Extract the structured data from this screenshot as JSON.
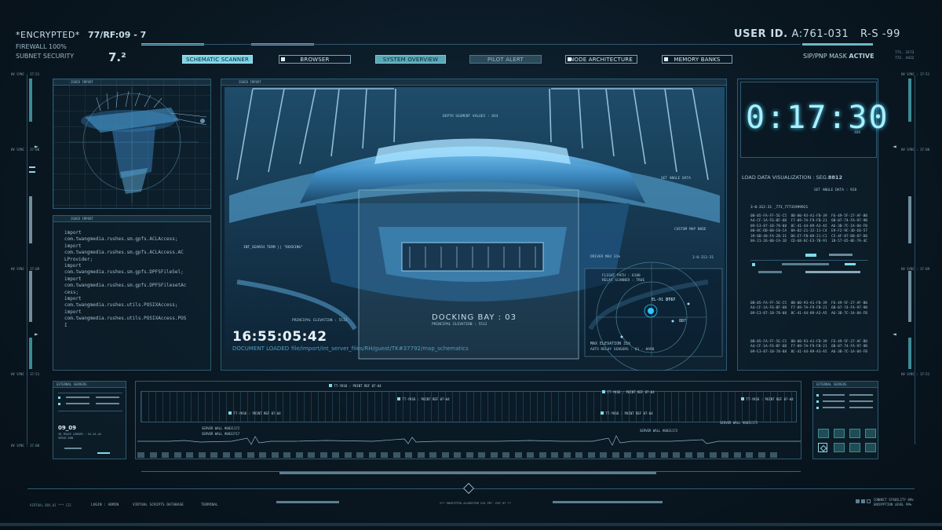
{
  "header": {
    "encrypted": "*ENCRYPTED*",
    "code": "77/RF:09 - 7",
    "firewall": "FIREWALL 100%",
    "subnet": "SUBNET SECURITY",
    "version": "7.²",
    "user_id_label": "USER ID.",
    "user_id_value": "A:761-031",
    "rs": "R-S -99",
    "mask_label": "SIP/PNP MASK",
    "mask_state": "ACTIVE",
    "mini_a": "771. 3173",
    "mini_b": "772. 4422"
  },
  "tabs": [
    {
      "label": "SCHEMATIC SCANNER",
      "state": "on"
    },
    {
      "label": "BROWSER",
      "state": "off"
    },
    {
      "label": "SYSTEM OVERVIEW",
      "state": "mid"
    },
    {
      "label": "PILOT ALERT",
      "state": "dark"
    },
    {
      "label": "NODE ARCHITECTURE",
      "state": "off"
    },
    {
      "label": "MEMORY BANKS",
      "state": "off"
    }
  ],
  "side": {
    "hv_sync": "HV SYNC : 37:51",
    "hv_sync2": "HV SYNC : 37:00",
    "hv_sync3": "HV SYNC : 37:09"
  },
  "left_panel_top": {
    "title": "ZOOED IMPORT"
  },
  "left_panel_code": {
    "title": "ZOOED IMPORT",
    "lines": [
      "import",
      "com.twangmedia.rushes.sm.gpfs.ACLAccess;",
      "import",
      "com.twangmedia.rushes.sm.gpfs.ACLAccess.AC",
      "LProvider;",
      "import",
      "com.twangmedia.rushes.sm.gpfs.DPFSFileSel;",
      "import",
      "com.twangmedia.rushes.sm.gpfs.DPFSFilesetAc",
      "cess;",
      "import",
      "com.twangmedia.rushes.utils.POSIXAccess;",
      "import",
      "com.twangmedia.rushes.utils.POSIXAccess.POS",
      "I"
    ]
  },
  "main": {
    "title": "ZOOED IMPORT",
    "depth": "DEPTH SEGMENT VALUES : 844",
    "set_angle": "SET ANGLE DATA",
    "custom_map": "CUSTOM MAP NODE",
    "driver_max": "DRIVER MAX 31%",
    "flight_path": "FLIGHT PATH : 6100",
    "relay": "RELAY SCANNER : TRUE",
    "search_term": "INT_SEARCH TERM || \"DOCKING\"",
    "principal": "PRINCIPAL ELEVATION : 5512",
    "docking": "DOCKING BAY : 03",
    "principal2": "PRINCIPAL ELEVATION : 5512",
    "time": "16:55:05:42",
    "doc_loaded": "DOCUMENT LOADED",
    "path": "file/import/int_server_files/RH/guest/TK#37792/map_schematics",
    "max_elev": "MAX ELEVATION 31%",
    "auto_relay": "AUTO RELAY SENSORS : 61 - 0998",
    "radar_label": "EL-01",
    "radar_value": "DT67",
    "radar_b": "887",
    "node_code": "3-0-312-31"
  },
  "right_panel": {
    "timer": "0:17:30",
    "timer_sub": "489",
    "load_data": "LOAD DATA VISUALIZATION : SEG.",
    "seg": "8812",
    "set_angle": "SET ANGLE DATA : 928",
    "seq": "3-0-312-31 _773_77731999921",
    "hex_a": [
      "0B-05-FA-FF-5E-C5  8B-00-93-A1-FB-39  F6-49-5F-27-AF-B0",
      "A4-CF-1A-F6-BF-6B  F7-09-7A-F9-FB-21  6B-07-74-FA-97-9B",
      "09-E3-87-1B-78-08  8C-41-44-89-A3-A5  A6-3B-7C-1A-84-FB",
      "00-8C-DD-00-C0-CA  8A-02-21-32-11-C4  E9-F2-9C-3D-E0-57",
      "39-6B-48-FA-2B-31  D6-E7-FB-89-21-C1  C5-4F-87-D8-87-D8",
      "8A-21-26-00-CA-1D  CD-68-6C-E3-7B-91  1B-57-65-0E-7A-4C"
    ],
    "hex_b": [
      "0B-05-FA-FF-5E-C5  8B-00-93-A1-FB-39  F6-49-5F-27-AF-B0",
      "A4-CF-1A-F6-BF-6B  F7-09-7A-F9-FB-21  6B-07-74-FA-97-9B",
      "09-E3-87-1B-78-08  8C-41-44-89-A3-A5  A6-3B-7C-1A-84-FB"
    ],
    "hex_c": [
      "0B-05-FA-FF-5E-C5  8B-00-93-A1-FB-39  F6-49-5F-27-AF-B0",
      "A4-CF-1A-F6-BF-6B  F7-09-7A-F9-FB-21  6B-07-74-FA-97-9B",
      "09-E3-87-1B-78-08  8C-41-44-89-A3-A5  A6-3B-7C-1A-84-FB"
    ]
  },
  "bottom_left": {
    "title": "EXTERNAL SERVERS",
    "code": "09_09",
    "sub": "ID_TRACE LEDGER : 54.44.44",
    "sub2": "SERVO RUN"
  },
  "timeline": {
    "markers": [
      "TT-YKSO : POINT REF 07-04",
      "TT-YKSO : POINT REF 07-04",
      "TT-YKSO : POINT REF 07-04",
      "TT-YKSO : POINT REF 07-04",
      "TT-YKSO : POINT REF 07-04",
      "TT-YKSO : POINT REF 07-04"
    ],
    "wall_a": "SERVER WALL #0031172",
    "wall_b": "SERVER WALL #0033717",
    "wall_c": "SERVER WALL #0031172",
    "wall_d": "SERVER WALL #0031172"
  },
  "bottom_right": {
    "title": "EXTERNAL SERVERS"
  },
  "footer": {
    "virtual": "VIRTUAL BOX_01 *** III",
    "login": "LOGIN : ADMIN",
    "scripts": "VIRTUAL SCRIPTS DATABASE",
    "terminal": "TERMINAL",
    "center": "2** ENCRYPTED ALGORITHM VIA PRT. REF 0Y **",
    "stability": "CONNECT STABILITY 89%",
    "encryption": "ENCRYPTION LEVEL 99%"
  },
  "colors": {
    "accent": "#7ed2e3",
    "teal": "#3d8a95",
    "bg": "#0a1620"
  }
}
